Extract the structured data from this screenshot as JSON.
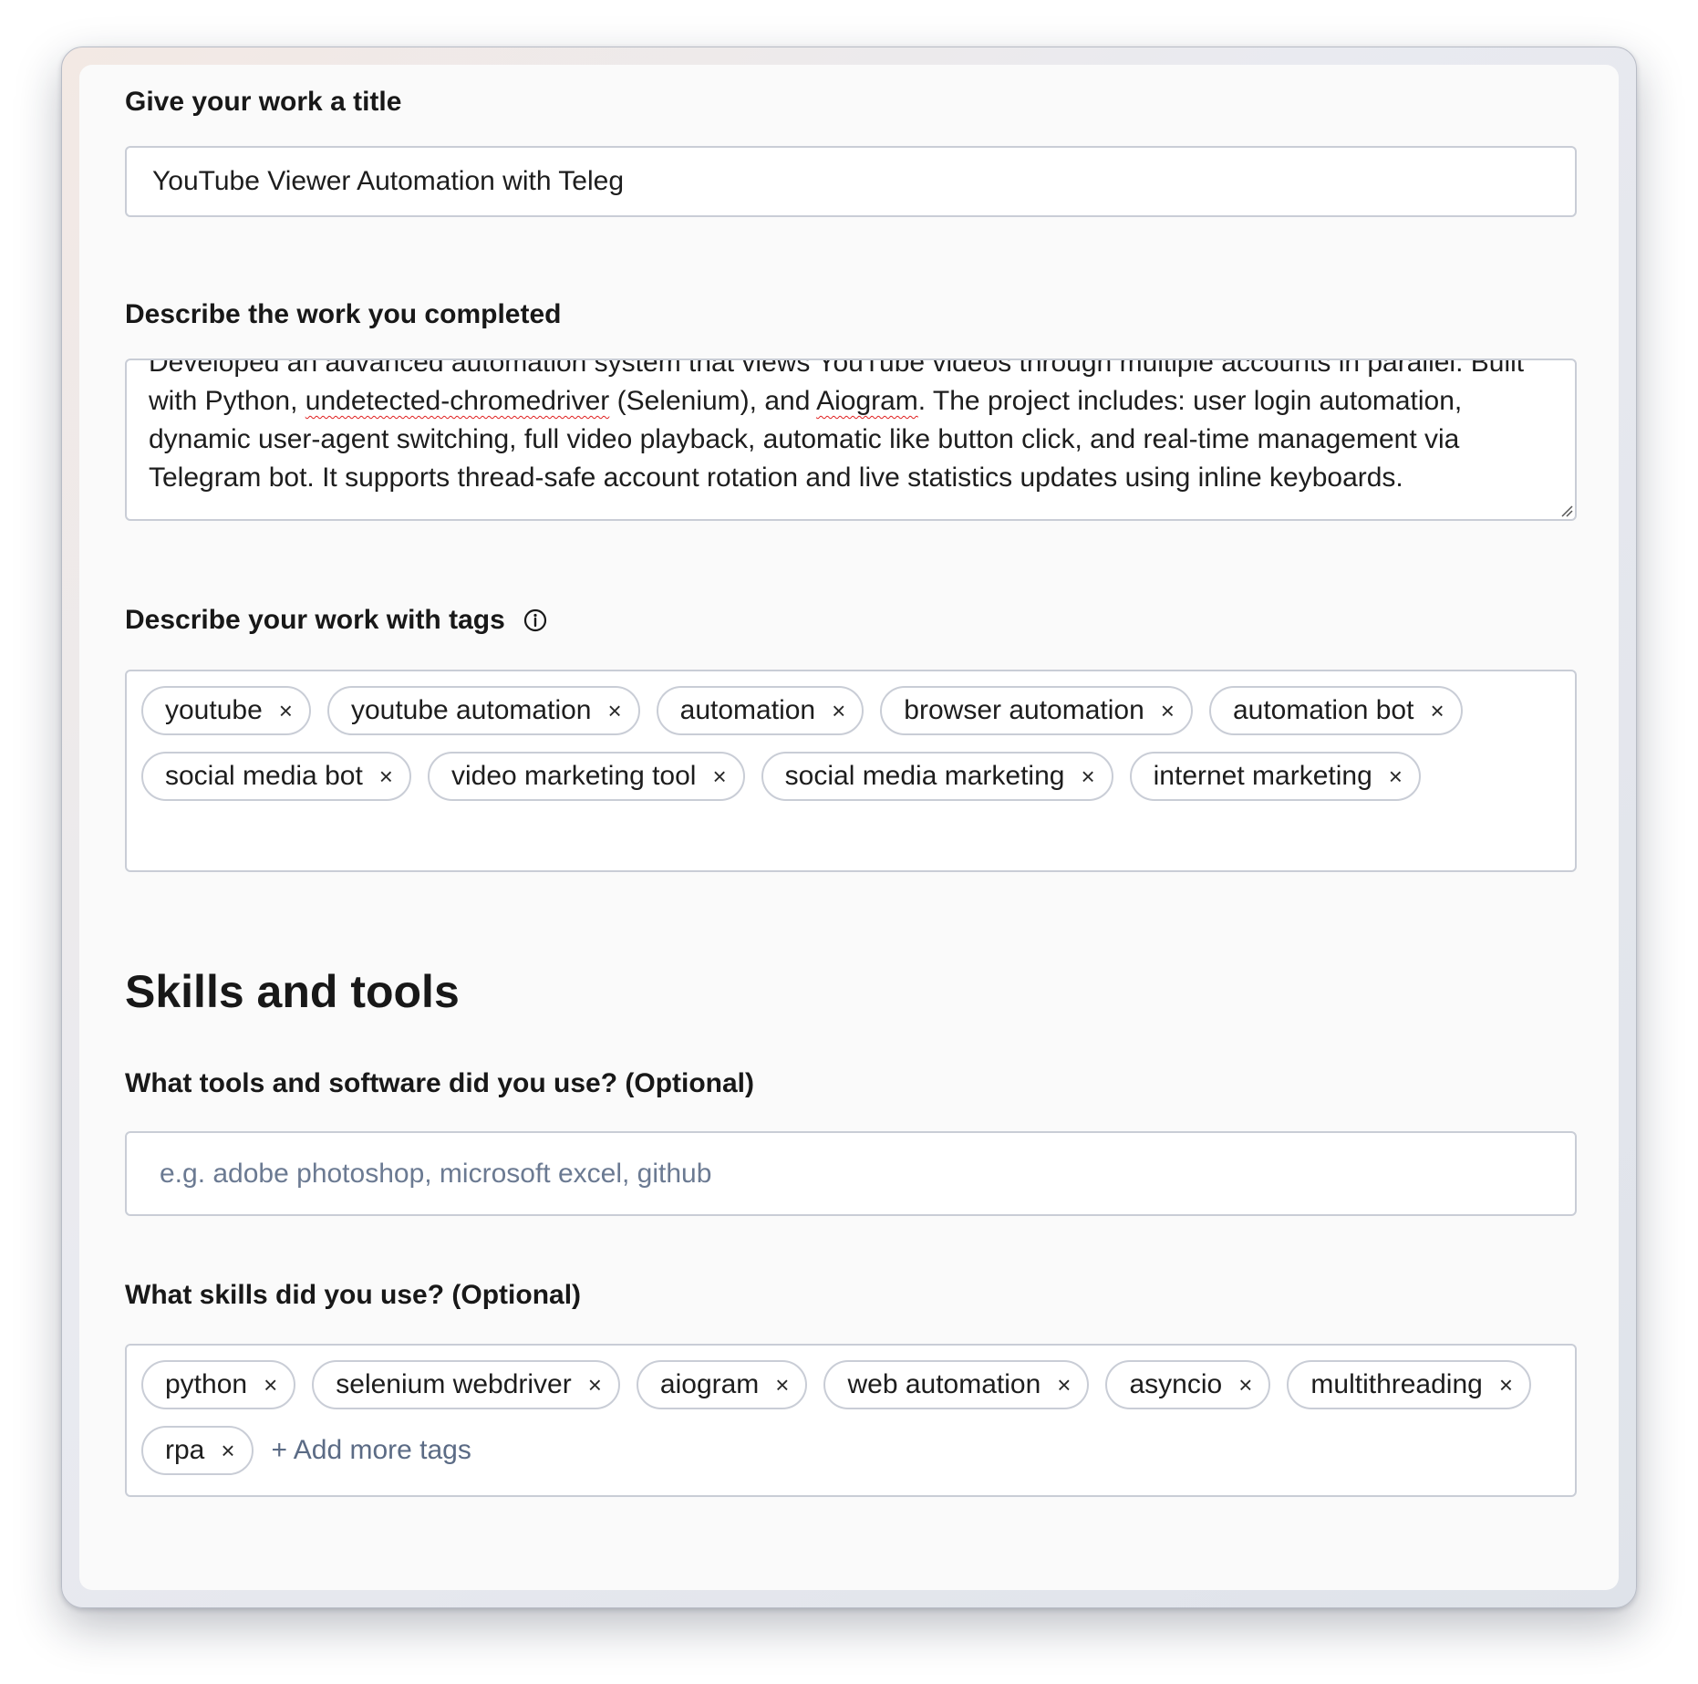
{
  "title_section": {
    "label": "Give your work a title",
    "value": "YouTube Viewer Automation with Teleg"
  },
  "description_section": {
    "label": "Describe the work you completed",
    "text_parts": {
      "p1": "Developed an advanced automation system that views YouTube videos through multiple accounts in parallel. Built with Python, ",
      "p2": "undetected-chromedriver",
      "p3": " (Selenium), and ",
      "p4": "Aiogram",
      "p5": ". The project includes: user login automation, dynamic user-agent switching, full video playback, automatic like button click, and real-time management via Telegram bot. It supports thread-safe account rotation and live statistics updates using inline keyboards."
    }
  },
  "tags_section": {
    "label": "Describe your work with tags",
    "info_icon": "info-circle-icon",
    "tags": [
      "youtube",
      "youtube automation",
      "automation",
      "browser automation",
      "automation bot",
      "social media bot",
      "video marketing tool",
      "social media marketing",
      "internet marketing"
    ]
  },
  "skills_tools": {
    "heading": "Skills and tools",
    "tools_label": "What tools and software did you use? (Optional)",
    "tools_placeholder": "e.g. adobe photoshop, microsoft excel, github",
    "skills_label": "What skills did you use? (Optional)",
    "skills": [
      "python",
      "selenium webdriver",
      "aiogram",
      "web automation",
      "asyncio",
      "multithreading",
      "rpa"
    ],
    "add_more_label": "+ Add more tags"
  },
  "remove_glyph": "×"
}
